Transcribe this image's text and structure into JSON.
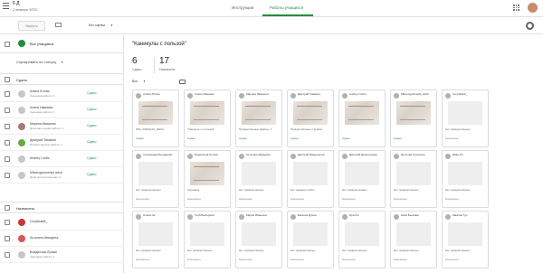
{
  "header": {
    "class_title": "6 Д",
    "class_subtitle": "2 четверть ФГОС",
    "tabs": [
      {
        "label": "Инструкции"
      },
      {
        "label": "Работы учащихся"
      }
    ]
  },
  "toolbar": {
    "return_label": "Вернуть",
    "grading_value": "Без оценки"
  },
  "sidebar": {
    "all_students_label": "Все учащиеся",
    "sort_label": "Сортировать по статусу",
    "section_submitted": "Сдано",
    "section_assigned": "Назначено",
    "submitted_students": [
      {
        "name": "Алина Югова",
        "sub": "Черновая работа: 1",
        "status": "Сдано"
      },
      {
        "name": "Алена Иванова",
        "sub": "Черновая работа: 1",
        "status": "Сдано"
      },
      {
        "name": "Марина Ивашина",
        "sub": "Дополнительная работа: 1",
        "status": "Сдано"
      },
      {
        "name": "Дмитрий Тимакин",
        "sub": "Прикреплённые файлы: 1",
        "status": "Сдано"
      },
      {
        "name": "Andrey Lohrts",
        "sub": "",
        "status": "Сдано"
      },
      {
        "name": "Mikonogolovenky arkdi",
        "sub": "Дана дополнительная: 1",
        "status": "Сдано"
      }
    ],
    "assigned_students": [
      {
        "name": "Сичуйский_",
        "sub": ""
      },
      {
        "name": "Ак-алина Шмидина",
        "sub": ""
      },
      {
        "name": "Владислав Лучкин",
        "sub": "Черновая работа: 1"
      }
    ]
  },
  "main": {
    "assignment_title": "\"Каникулы с пользой\"",
    "stats": [
      {
        "value": "6",
        "label": "Сдано"
      },
      {
        "value": "17",
        "label": "Назначено"
      }
    ],
    "filter_label": "Все",
    "cards": [
      {
        "name": "Алина Югова",
        "caption": "IMG_20200123_18234-...",
        "status": "Сдано",
        "thumb": true
      },
      {
        "name": "Алена Иванова",
        "caption": "\"Каникулы с пользой\"",
        "status": "Сдано",
        "thumb": true
      },
      {
        "name": "Марина Ивашина",
        "caption": "Прикреплённые файлы: 1",
        "status": "Сдано",
        "thumb": true
      },
      {
        "name": "Дмитрий Тимакин",
        "caption": "Прикреплённые 2 файла",
        "status": "Сдано",
        "thumb": true
      },
      {
        "name": "Andrey Lohrts",
        "caption": "",
        "status": "Сдано",
        "thumb": true
      },
      {
        "name": "Mikonogolovenky arkdi",
        "caption": "",
        "status": "Сдано",
        "thumb": true
      },
      {
        "name": "Сичуйский_",
        "caption": "Нет прикреплённых",
        "status": "Назначено",
        "thumb": false
      },
      {
        "name": "Александра Богданова",
        "caption": "Нет прикреплённых",
        "status": "Назначено",
        "thumb": false
      },
      {
        "name": "Владислав Лучкин",
        "caption": "Черновик",
        "status": "Назначено",
        "thumb": true
      },
      {
        "name": "Ак-алина Шмидина",
        "caption": "Нет прикреплённых",
        "status": "Назначено",
        "thumb": false
      },
      {
        "name": "Дмитрий Бандалетов",
        "caption": "Нет сданных работ",
        "status": "Назначено",
        "thumb": false
      },
      {
        "name": "Дмитрий Данильченко",
        "caption": "Нет прикреплённых",
        "status": "Назначено",
        "thumb": false
      },
      {
        "name": "Ярослав Трушкина",
        "caption": "Нет прикреплённых",
        "status": "Назначено",
        "thumb": false
      },
      {
        "name": "Иван Ох",
        "caption": "Нет прикреплённых",
        "status": "Назначено",
        "thumb": false
      },
      {
        "name": "Алина Ок",
        "caption": "Нет прикреплённых",
        "status": "Назначено",
        "thumb": false
      },
      {
        "name": "Глеб Выборнов",
        "caption": "Нет прикреплённых",
        "status": "Назначено",
        "thumb": false
      },
      {
        "name": "Мария Ивашина",
        "caption": "Нет прикреплённых",
        "status": "Назначено",
        "thumb": false
      },
      {
        "name": "Евгения Дунин",
        "caption": "Нет прикреплённых",
        "status": "Назначено",
        "thumb": false
      },
      {
        "name": "Ира Рог",
        "caption": "Нет прикреплённых",
        "status": "Назначено",
        "thumb": false
      },
      {
        "name": "Ника Бычкова",
        "caption": "Нет прикреплённых",
        "status": "Назначено",
        "thumb": false
      },
      {
        "name": "Максим Тур",
        "caption": "Нет прикреплённых",
        "status": "Назначено",
        "thumb": false
      }
    ]
  }
}
